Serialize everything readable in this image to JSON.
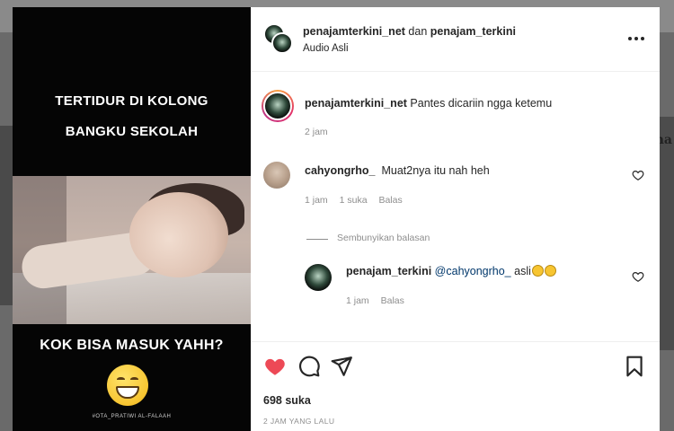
{
  "background": {
    "right_text": "ma"
  },
  "media": {
    "top_line1": "TERTIDUR DI KOLONG",
    "top_line2": "BANGKU SEKOLAH",
    "bottom_line": "KOK BISA MASUK YAHH?",
    "watermark": "#OTA_PRATIWI AL-FALAAH"
  },
  "header": {
    "author": "penajamterkini_net",
    "connector": " dan ",
    "coauthor": "penajam_terkini",
    "audio": "Audio Asli"
  },
  "caption": {
    "username": "penajamterkini_net",
    "text": "Pantes dicariin ngga ketemu",
    "time": "2 jam"
  },
  "comments": [
    {
      "username": "cahyongrho_",
      "text": "Muat2nya itu nah heh",
      "time": "1 jam",
      "likes": "1 suka",
      "reply": "Balas"
    }
  ],
  "replies_toggle": "Sembunyikan balasan",
  "replies": [
    {
      "username": "penajam_terkini",
      "mention": "@cahyongrho_",
      "text": "asli",
      "time": "1 jam",
      "reply": "Balas"
    }
  ],
  "stats": {
    "likes": "698 suka",
    "time_ago": "2 JAM YANG LALU",
    "liked": true
  },
  "colors": {
    "like_red": "#ed4956",
    "mention_blue": "#00376b",
    "muted": "#8e8e8e",
    "text": "#262626"
  }
}
